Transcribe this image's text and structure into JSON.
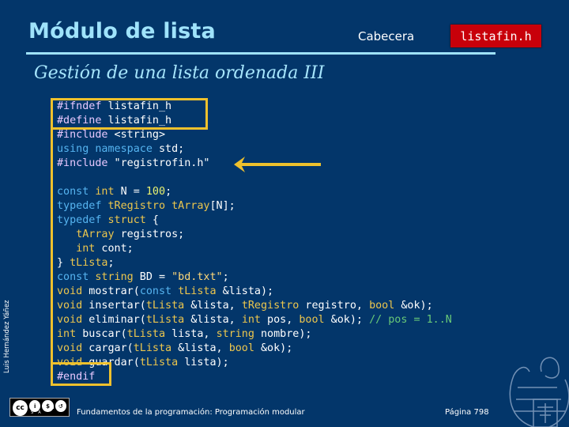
{
  "header": {
    "title": "Módulo de lista",
    "section_label": "Cabecera",
    "file_badge": "listafin.h"
  },
  "subtitle": "Gestión de una lista ordenada III",
  "code": {
    "preamble": [
      "#ifndef listafin_h",
      "#define listafin_h",
      "#include <string>",
      "using namespace std;",
      "#include \"registrofin.h\""
    ],
    "body": [
      "const int N = 100;",
      "typedef tRegistro tArray[N];",
      "typedef struct {",
      "   tArray registros;",
      "   int cont;",
      "} tLista;",
      "const string BD = \"bd.txt\";",
      "void mostrar(const tLista &lista);",
      "void insertar(tLista &lista, tRegistro registro, bool &ok);",
      "void eliminar(tLista &lista, int pos, bool &ok); // pos = 1..N",
      "int buscar(tLista lista, string nombre);",
      "void cargar(tLista &lista, bool &ok);",
      "void guardar(tLista lista);",
      "#endif"
    ]
  },
  "sidebar_author": "Luis Hernández Yáñez",
  "license": {
    "badge": "cc",
    "labels": "BY NC SA"
  },
  "footer": {
    "course": "Fundamentos de la programación: Programación modular",
    "page": "Página 798"
  },
  "colors": {
    "background": "#03366a",
    "title": "#9fe3fb",
    "badge": "#c8000a",
    "highlight_box": "#eec12d"
  }
}
